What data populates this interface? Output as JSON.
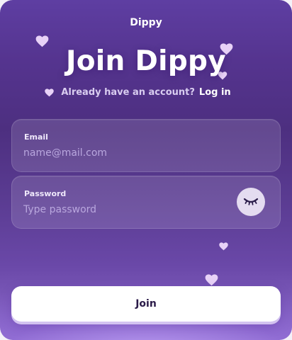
{
  "app": {
    "brand": "Dippy",
    "headline": "Join Dippy",
    "subline": {
      "prompt": "Already have an account?",
      "login_link": "Log in"
    }
  },
  "form": {
    "email": {
      "label": "Email",
      "placeholder": "name@mail.com",
      "value": ""
    },
    "password": {
      "label": "Password",
      "placeholder": "Type password",
      "value": "",
      "toggle_icon": "closed-eye-icon"
    },
    "submit_label": "Join"
  },
  "decorations": {
    "heart_icon": "heart-icon",
    "heart_color": "#e8d2f7"
  },
  "colors": {
    "background_top": "#5e3ea2",
    "background_bottom": "#8e6ccd",
    "button_bg": "#ffffff",
    "button_text": "#2a1a48",
    "placeholder": "#b9a7de"
  }
}
